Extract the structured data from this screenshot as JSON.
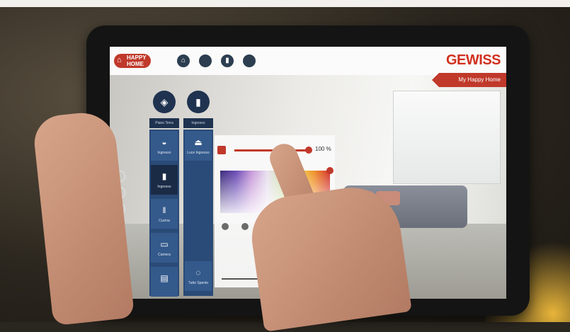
{
  "app": {
    "logo_line1": "HAPPY",
    "logo_line2": "HOME",
    "brand": "GEWISS",
    "location_label": "My Happy Home"
  },
  "top_nav": [
    {
      "name": "home-icon",
      "glyph": "⌂"
    },
    {
      "name": "circle-icon",
      "glyph": "●"
    },
    {
      "name": "door-icon",
      "glyph": "▮"
    },
    {
      "name": "circle-icon-2",
      "glyph": "●"
    }
  ],
  "columns": {
    "left_header": "Piano Terra",
    "right_header": "Ingresso",
    "left_items": [
      {
        "label": "Ingresso",
        "icon": "lamp-icon"
      },
      {
        "label": "Ingresso",
        "icon": "light-icon"
      },
      {
        "label": "Cucina",
        "icon": "cutlery-icon"
      },
      {
        "label": "Camera",
        "icon": "bed-icon"
      },
      {
        "label": "",
        "icon": "shutter-icon"
      }
    ],
    "right_items": [
      {
        "label": "Luce Ingresso",
        "icon": "ceiling-lamp-icon"
      },
      {
        "label": "Tutto Spento",
        "icon": "power-icon"
      }
    ]
  },
  "panel": {
    "brightness_percent": "100 %",
    "brightness_value": 1.0
  },
  "colors": {
    "accent_red": "#c0392b",
    "nav_dark": "#1f3350",
    "column_blue": "#2a4a77"
  }
}
